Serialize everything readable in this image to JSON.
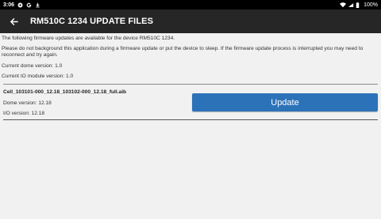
{
  "status_bar": {
    "time": "3:06",
    "notif_icons": [
      "gear-notification-icon",
      "google-icon",
      "download-icon"
    ],
    "battery": "100%"
  },
  "app_bar": {
    "title": "RM510C 1234 UPDATE FILES"
  },
  "info": {
    "available_text": "The following firmware updates are available for the device RM510C 1234.",
    "warning_text": "Please do not background this application during a firmware update or put the device to sleep. If the firmware update process is interrupted you may need to reconnect and try again.",
    "dome_version": "Current dome version: 1.0",
    "io_version": "Current IO module version: 1.0"
  },
  "firmware": [
    {
      "filename": "Cell_103101-000_12.18_103102-000_12.18_full.aib",
      "dome_version": "Dome version: 12.18",
      "io_version": "I/O version: 12.18",
      "button_label": "Update"
    }
  ],
  "colors": {
    "status_bar": "#000000",
    "app_bar": "#262626",
    "background": "#f1f1f1",
    "button": "#2c72b8"
  }
}
